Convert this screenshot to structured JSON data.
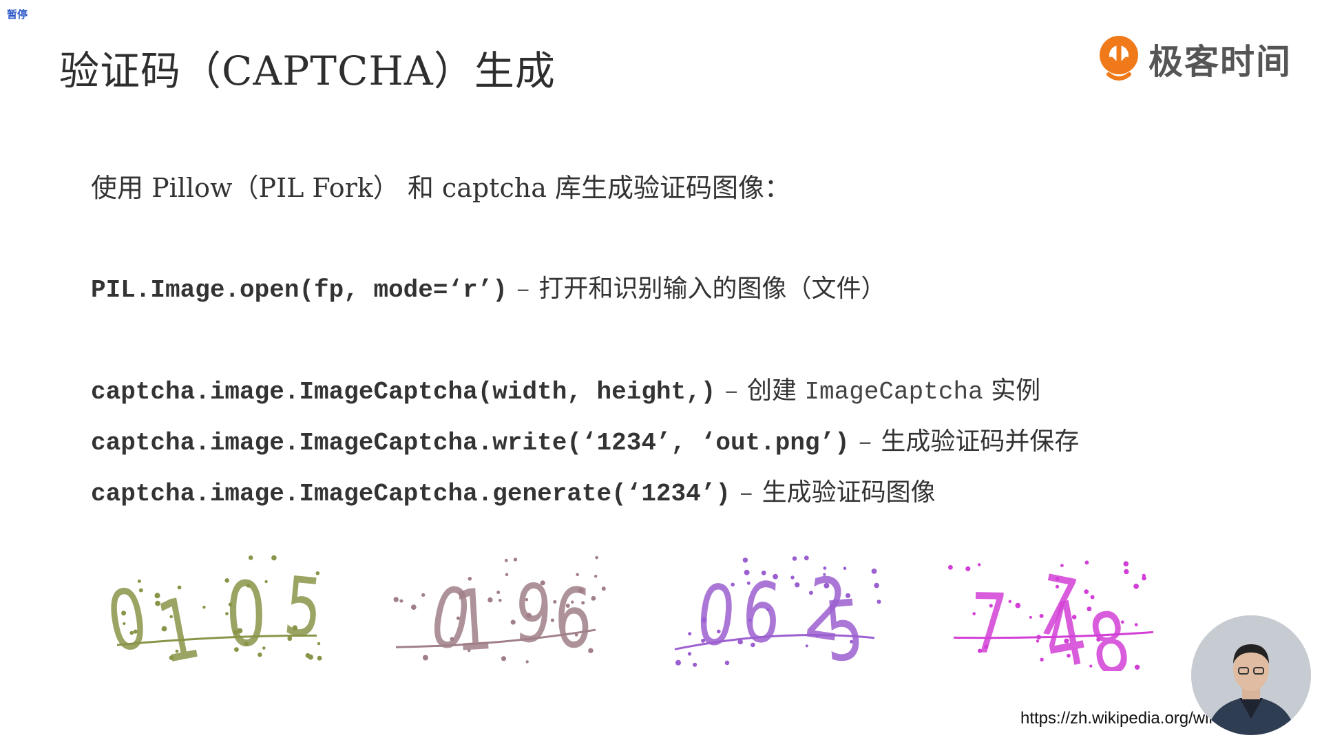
{
  "overlay": {
    "pause_label": "暂停"
  },
  "slide": {
    "title": "验证码（CAPTCHA）生成",
    "logo_text": "极客时间",
    "intro": "使用 Pillow（PIL Fork） 和 captcha 库生成验证码图像：",
    "api_lines": [
      {
        "code": "PIL.Image.open(fp, mode=‘r’)",
        "dash": "–",
        "desc": "打开和识别输入的图像（文件）"
      },
      {
        "code": "captcha.image.ImageCaptcha(width, height,)",
        "dash": "–",
        "desc_prefix": "创建",
        "desc_mono": "ImageCaptcha",
        "desc_suffix": "实例"
      },
      {
        "code": "captcha.image.ImageCaptcha.write(‘1234’, ‘out.png’)",
        "dash": "–",
        "desc": "生成验证码并保存"
      },
      {
        "code": "captcha.image.ImageCaptcha.generate(‘1234’)",
        "dash": "–",
        "desc": "生成验证码图像"
      }
    ],
    "captcha_examples": [
      {
        "text": "0105",
        "color": "#8a9448"
      },
      {
        "text": "0196",
        "color": "#a07f88"
      },
      {
        "text": "0625",
        "color": "#9b5fd0"
      },
      {
        "text": "7748",
        "color": "#d23fd6"
      }
    ],
    "source_url": "https://zh.wikipedia.org/wiki/"
  },
  "colors": {
    "logo_orange": "#f07a1a",
    "badge_blue": "#2b57c9"
  }
}
